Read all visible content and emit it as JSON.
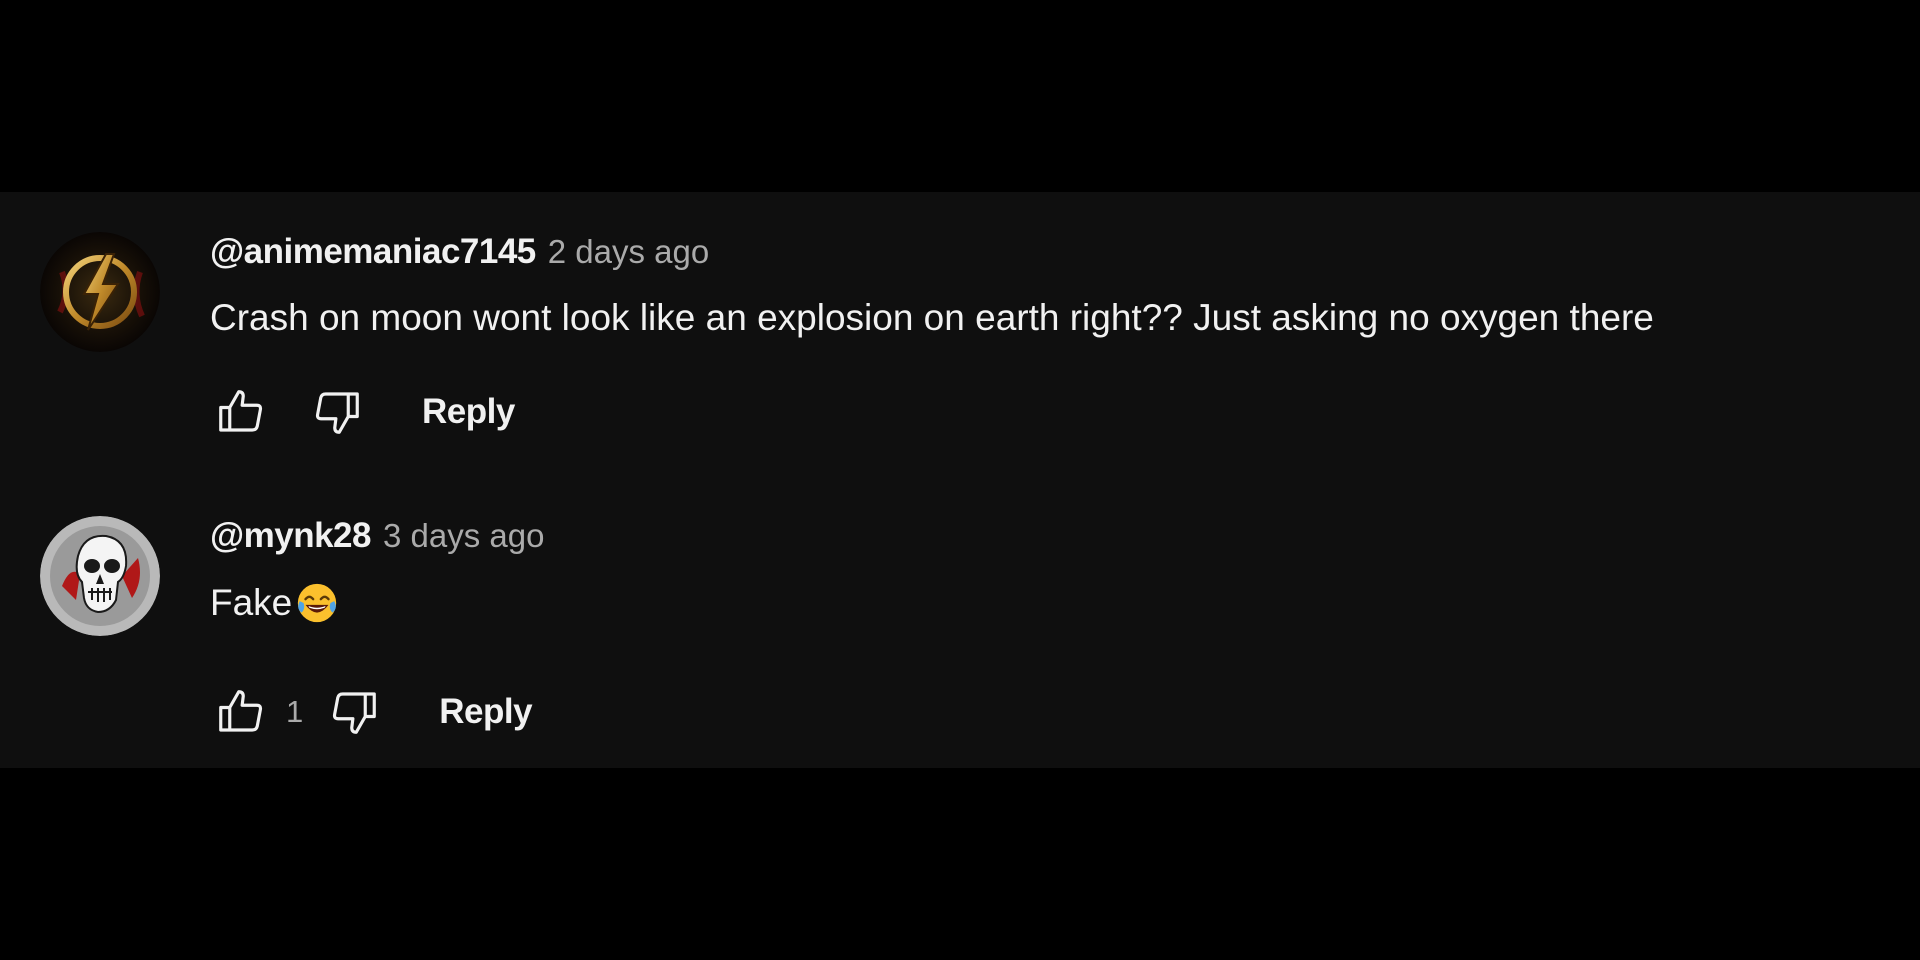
{
  "comments": [
    {
      "author": "@animemaniac7145",
      "time": "2 days ago",
      "text": "Crash on moon wont look like an explosion on earth right?? Just asking no oxygen there",
      "avatar_icon": "lightning-emblem-avatar",
      "like_count": "",
      "reply_label": "Reply"
    },
    {
      "author": "@mynk28",
      "time": "3 days ago",
      "text": "Fake",
      "text_emoji": "face-with-tears-of-joy-emoji",
      "avatar_icon": "skull-avatar",
      "like_count": "1",
      "reply_label": "Reply"
    }
  ],
  "colors": {
    "background": "#0f0f0f",
    "letterbox": "#000000",
    "primary_text": "#f1f1f1",
    "secondary_text": "#aaaaaa"
  }
}
